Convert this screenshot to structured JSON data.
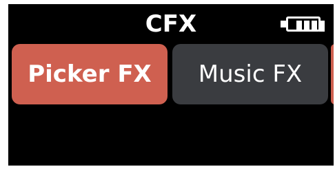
{
  "header": {
    "title": "CFX",
    "battery_icon": "battery-full-icon",
    "battery_level": 1.0
  },
  "tabs": [
    {
      "label": "Picker FX",
      "selected": true,
      "color": "#cf6050"
    },
    {
      "label": "Music FX",
      "selected": false,
      "color": "#3a3c40"
    }
  ]
}
